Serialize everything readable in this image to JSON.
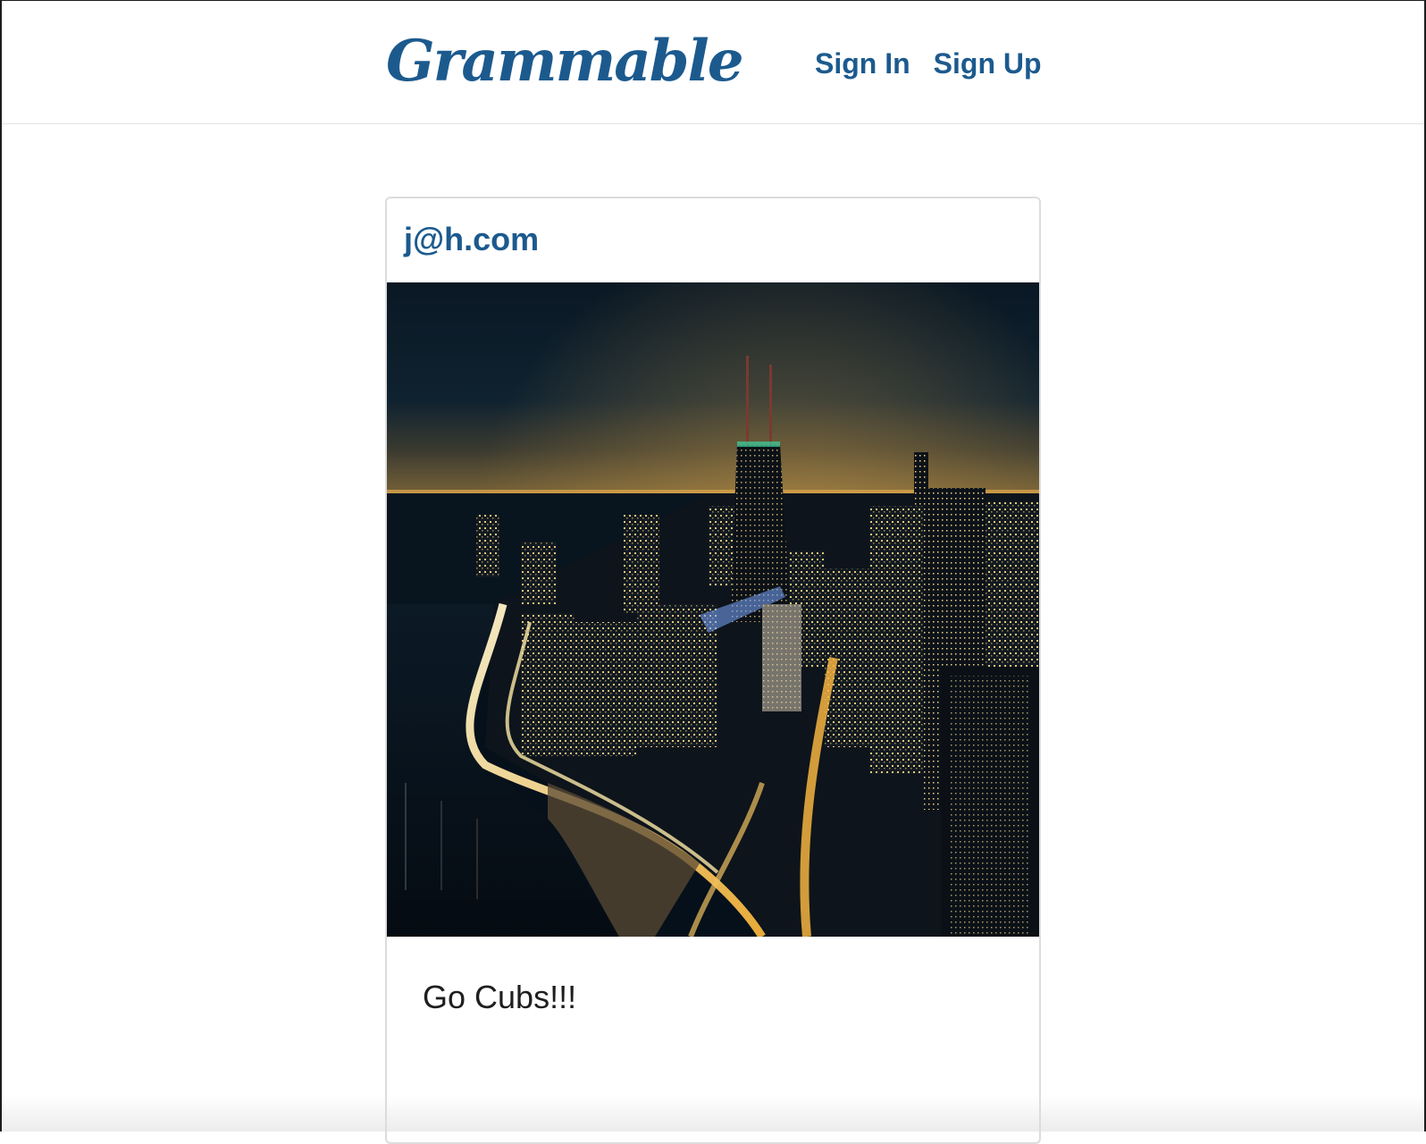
{
  "nav": {
    "brand": "Grammable",
    "sign_in": "Sign In",
    "sign_up": "Sign Up"
  },
  "post": {
    "user": "j@h.com",
    "caption": "Go Cubs!!!",
    "photo_description_icon": "night-city-skyline-photo"
  },
  "colors": {
    "accent": "#1c5a8e",
    "text": "#1e1e1e",
    "border": "#dcdcdc"
  }
}
